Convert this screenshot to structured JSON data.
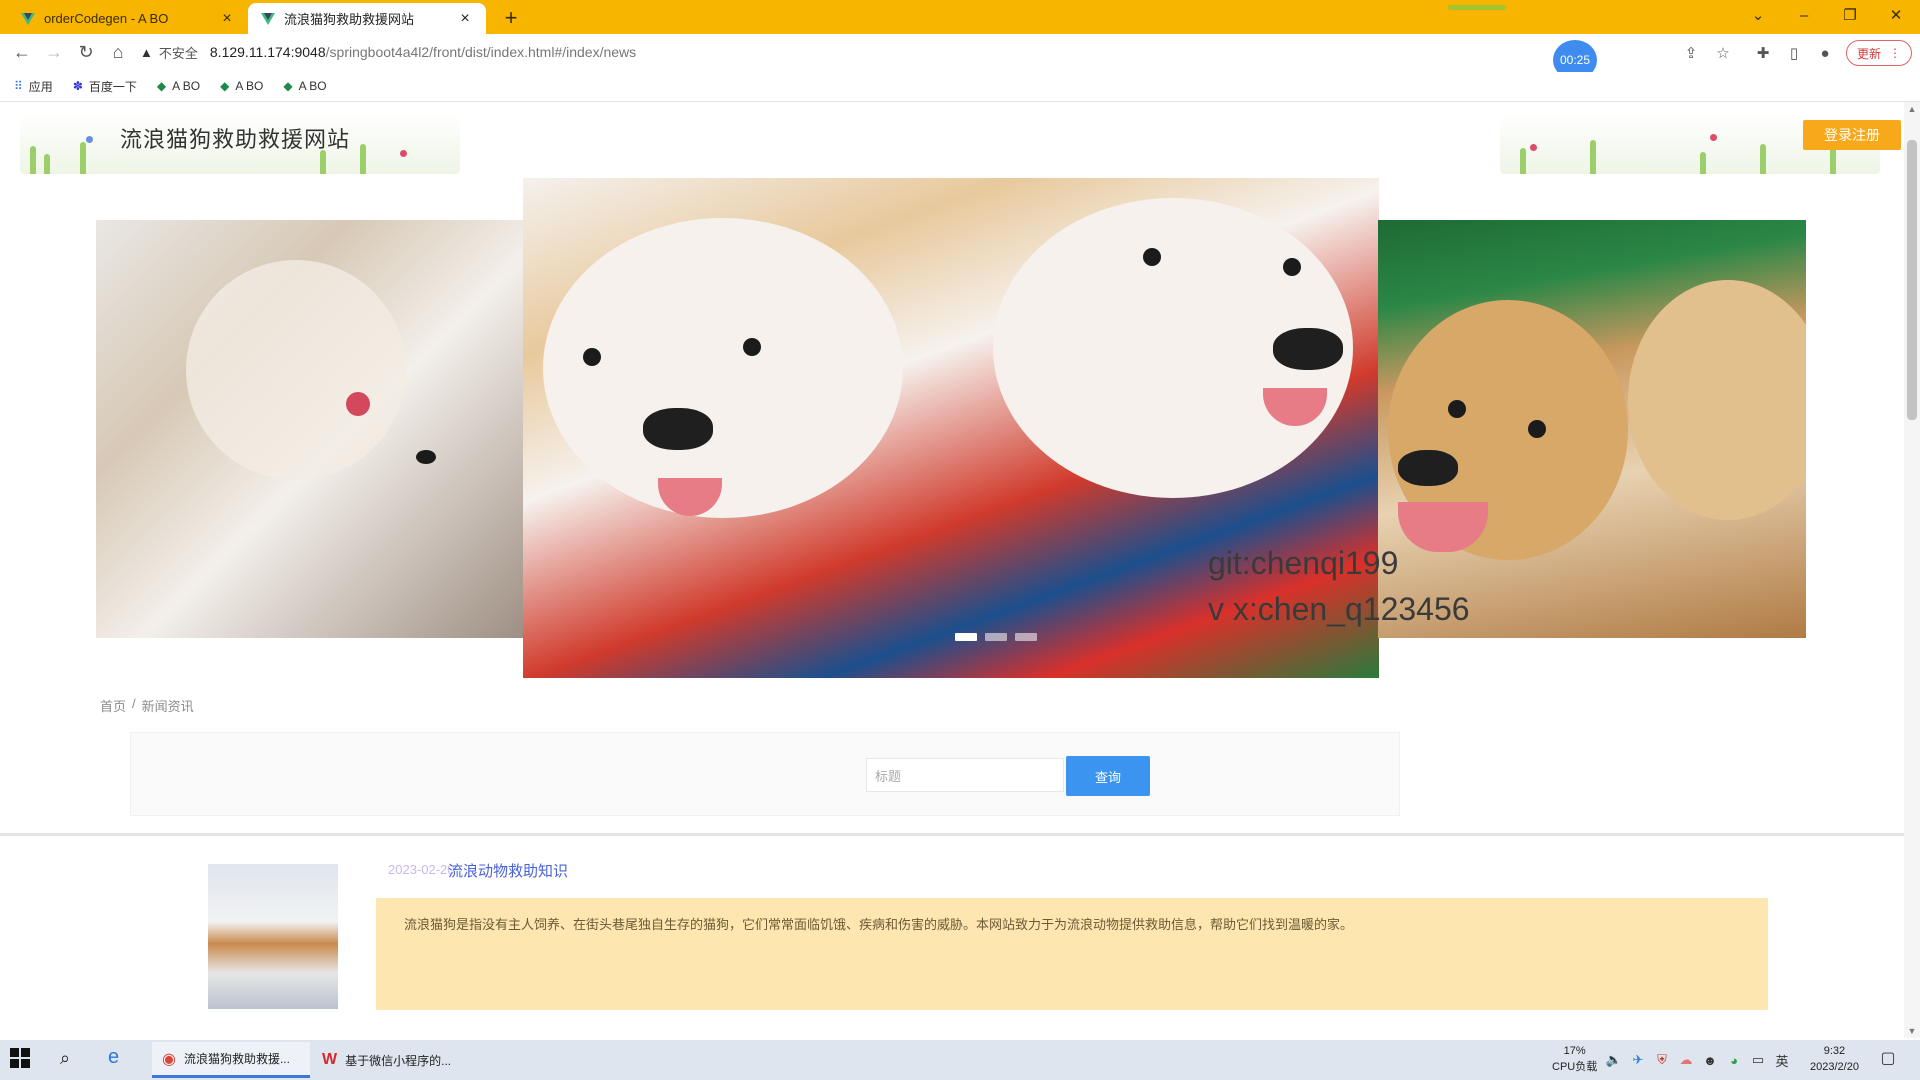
{
  "browser": {
    "tabs": [
      {
        "title": "orderCodegen - A BO",
        "close": "×"
      },
      {
        "title": "流浪猫狗救助救援网站",
        "close": "×"
      }
    ],
    "new_tab": "+",
    "window_controls": {
      "dropdown": "⌄",
      "minimize": "–",
      "restore": "❐",
      "close": "✕"
    },
    "insecure_label": "不安全",
    "url_host": "8.129.11.174:9048",
    "url_path": "/springboot4a4l2/front/dist/index.html#/index/news",
    "record_timer": "00:25",
    "update_label": "更新"
  },
  "bookmarks": [
    {
      "label": "应用",
      "icon": "apps-grid-icon"
    },
    {
      "label": "百度一下",
      "icon": "baidu-paw-icon"
    },
    {
      "label": "A BO",
      "icon": "leaf-icon"
    },
    {
      "label": "A BO",
      "icon": "leaf-icon"
    },
    {
      "label": "A BO",
      "icon": "leaf-icon"
    }
  ],
  "site": {
    "title": "流浪猫狗救助救援网站",
    "login_button": "登录注册"
  },
  "carousel": {
    "watermark_line1": "git:chenqi199",
    "watermark_line2": "v x:chen_q123456",
    "active_index": 0,
    "slide_count": 3
  },
  "breadcrumb": {
    "home": "首页",
    "sep": "/",
    "current": "新闻资讯"
  },
  "search": {
    "placeholder": "标题",
    "button": "查询"
  },
  "news": [
    {
      "date": "2023-02-20",
      "title": "流浪动物救助知识",
      "summary": "流浪猫狗是指没有主人饲养、在街头巷尾独自生存的猫狗，它们常常面临饥饿、疾病和伤害的威胁。本网站致力于为流浪动物提供救助信息，帮助它们找到温暖的家。"
    }
  ],
  "taskbar": {
    "apps": [
      {
        "label": "流浪猫狗救助救援...",
        "icon": "chrome-icon",
        "active": true
      },
      {
        "label": "基于微信小程序的...",
        "icon": "wps-icon",
        "active": false
      }
    ],
    "cpu_percent": "17%",
    "cpu_label": "CPU负载",
    "ime": "英",
    "time": "9:32",
    "date": "2023/2/20"
  },
  "colors": {
    "tab_strip": "#f7b500",
    "login_button": "#f7a81b",
    "search_button": "#3a94f0",
    "news_summary_bg": "#fde6b0",
    "news_title": "#4a62d8"
  }
}
